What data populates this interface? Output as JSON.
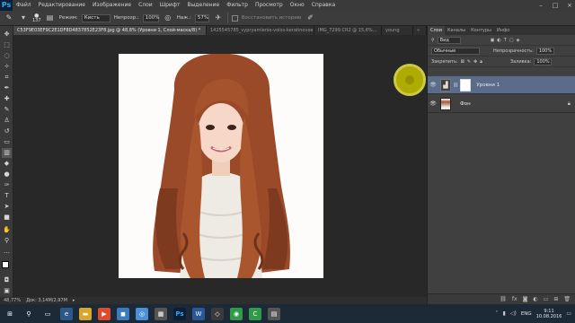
{
  "menubar": {
    "logo": "Ps",
    "items": [
      "Файл",
      "Редактирование",
      "Изображение",
      "Слои",
      "Шрифт",
      "Выделение",
      "Фильтр",
      "Просмотр",
      "Окно",
      "Справка"
    ]
  },
  "options": {
    "brush_size": "137",
    "mode_label": "Режим:",
    "mode_value": "Кисть",
    "opacity_label": "Непрозр.:",
    "opacity_value": "100%",
    "flow_label": "Наж.:",
    "flow_value": "57%",
    "history_label": "Восстановить историю"
  },
  "tabs": [
    "C53F9E03EF9C2E1DF8D4837852E23F8.jpg @ 48,8% (Уровни 1, Слой-маска/8) *",
    "1425545785_vypryamlenie-volos-keratinovoe.jpg",
    "IMG_7299.CR2 @ 15,6%...",
    "young"
  ],
  "panel": {
    "tabs": [
      "Слои",
      "Каналы",
      "Контуры",
      "Инфо"
    ],
    "kind_label": "Вид",
    "blend_mode": "Обычные",
    "opacity_label": "Непрозрачность:",
    "opacity_value": "100%",
    "lock_label": "Закрепить:",
    "fill_label": "Заливка:",
    "fill_value": "100%",
    "layers": [
      {
        "name": "Уровни 1"
      },
      {
        "name": "Фон"
      }
    ]
  },
  "status": {
    "zoom": "48,77%",
    "doc": "Док: 3,14M/2,97M"
  },
  "taskbar": {
    "lang": "ENG",
    "time": "9:11",
    "date": "10.08.2016"
  },
  "colors": {
    "accent_layer": "#5a6c8a",
    "brush_cursor": "#b6b300"
  }
}
